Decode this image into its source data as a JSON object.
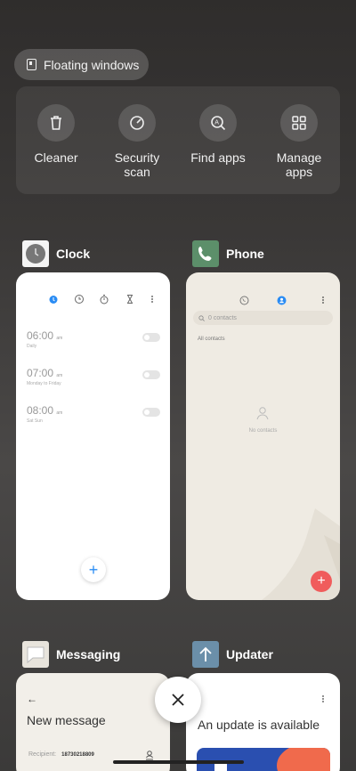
{
  "floating": {
    "label": "Floating windows"
  },
  "tools": [
    {
      "label": "Cleaner",
      "icon": "trash-icon"
    },
    {
      "label": "Security scan",
      "icon": "gauge-icon"
    },
    {
      "label": "Find apps",
      "icon": "find-apps-icon"
    },
    {
      "label": "Manage apps",
      "icon": "grid-icon"
    }
  ],
  "apps": {
    "clock": {
      "name": "Clock",
      "alarms": [
        {
          "time": "06:00",
          "ampm": "am",
          "repeat": "Daily"
        },
        {
          "time": "07:00",
          "ampm": "am",
          "repeat": "Monday to Friday"
        },
        {
          "time": "08:00",
          "ampm": "am",
          "repeat": "Sat Sun"
        }
      ]
    },
    "phone": {
      "name": "Phone",
      "search_placeholder": "0 contacts",
      "section": "All contacts",
      "empty": "No contacts"
    },
    "messaging": {
      "name": "Messaging",
      "title": "New message",
      "recipient_label": "Recipient:",
      "recipient_value": "18730218809"
    },
    "updater": {
      "name": "Updater",
      "title": "An update is available"
    }
  },
  "colors": {
    "accent_blue": "#2a8cf4",
    "fab_red": "#f05c5c",
    "phone_icon_bg": "#5c8f6a",
    "updater_icon_bg": "#6b8fa9"
  }
}
